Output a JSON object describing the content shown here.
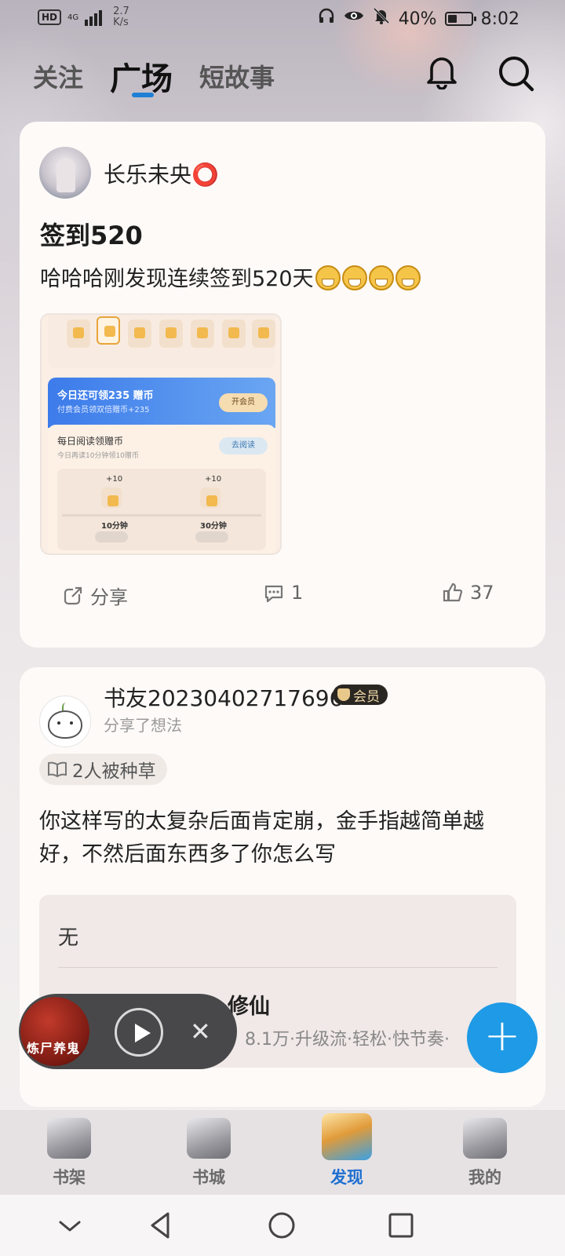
{
  "status_bar": {
    "hd": "HD",
    "network": "4G",
    "speed_value": "2.7",
    "speed_unit": "K/s",
    "battery_percent": "40%",
    "battery_level": 0.4,
    "time": "8:02",
    "icons": [
      "headphones-icon",
      "eye-icon",
      "mute-bell-icon",
      "battery-icon"
    ]
  },
  "top_nav": {
    "tabs": [
      {
        "label": "关注"
      },
      {
        "label": "广场"
      },
      {
        "label": "短故事"
      }
    ],
    "active_tab": "广场",
    "accent_color": "#1d7fd6"
  },
  "posts": [
    {
      "username": "长乐未央⭕",
      "title": "签到520",
      "text": "哈哈哈刚发现连续签到520天",
      "image": {
        "banner_title": "今日还可领235 赠币",
        "banner_sub": "付费会员领双倍赠币+235",
        "banner_button": "开会员",
        "task_title": "每日阅读领赠币",
        "task_sub": "今日再读10分钟领10赠币",
        "task_button": "去阅读",
        "rewards": [
          {
            "plus": "+10",
            "time": "10分钟"
          },
          {
            "plus": "+10",
            "time": "30分钟"
          }
        ]
      },
      "actions": {
        "share_label": "分享",
        "comment_count": "1",
        "like_count": "37"
      }
    },
    {
      "username": "书友20230402717696",
      "badge": "会员",
      "subtitle": "分享了想法",
      "tag": "2人被种草",
      "text": "你这样写的太复杂后面肯定崩，金手指越简单越好，不然后面东西多了你怎么写",
      "quote": {
        "line1": "无",
        "book_title": "修仙",
        "book_meta": "8.1万·升级流·轻松·快节奏·"
      }
    }
  ],
  "player": {
    "cover_text": "炼尸养鬼"
  },
  "fab": {
    "label": "+",
    "color": "#1e9ae6"
  },
  "tab_bar": {
    "items": [
      {
        "label": "书架",
        "icon": "bookshelf-icon"
      },
      {
        "label": "书城",
        "icon": "bookstore-icon"
      },
      {
        "label": "发现",
        "icon": "discover-icon"
      },
      {
        "label": "我的",
        "icon": "profile-icon"
      }
    ],
    "active": "发现",
    "active_color": "#1e6fd0"
  },
  "system_nav": [
    "collapse-icon",
    "back-icon",
    "home-icon",
    "recents-icon"
  ]
}
